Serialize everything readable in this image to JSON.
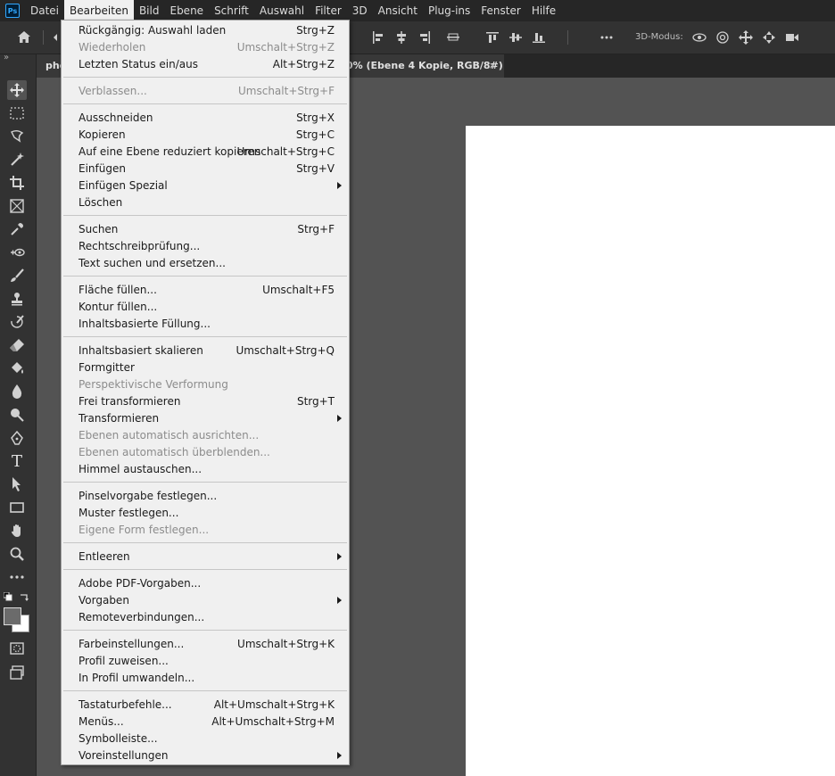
{
  "menubar": {
    "logo": "Ps",
    "items": [
      "Datei",
      "Bearbeiten",
      "Bild",
      "Ebene",
      "Schrift",
      "Auswahl",
      "Filter",
      "3D",
      "Ansicht",
      "Plug-ins",
      "Fenster",
      "Hilfe"
    ],
    "active_index": 1
  },
  "options": {
    "mode_label": "3D-Modus:"
  },
  "tabs": [
    {
      "label": "pho"
    },
    {
      "label": "0% (Ebene 4 Kopie, RGB/8#) *",
      "close": "×"
    }
  ],
  "toolbar": {
    "collapse": "»",
    "tools": [
      "move-tool-icon",
      "marquee-tool-icon",
      "lasso-tool-icon",
      "magic-wand-icon",
      "crop-tool-icon",
      "frame-tool-icon",
      "eyedropper-icon",
      "healing-brush-icon",
      "brush-tool-icon",
      "stamp-tool-icon",
      "history-brush-icon",
      "eraser-icon",
      "paint-bucket-icon",
      "blur-tool-icon",
      "dodge-tool-icon",
      "pen-tool-icon",
      "type-tool-icon",
      "path-select-icon",
      "rectangle-tool-icon",
      "hand-tool-icon",
      "zoom-tool-icon",
      "more-tools-icon"
    ],
    "text_tool_label": "T"
  },
  "menu": {
    "groups": [
      [
        {
          "label": "Rückgängig: Auswahl laden",
          "shortcut": "Strg+Z"
        },
        {
          "label": "Wiederholen",
          "shortcut": "Umschalt+Strg+Z",
          "disabled": true
        },
        {
          "label": "Letzten Status ein/aus",
          "shortcut": "Alt+Strg+Z"
        }
      ],
      [
        {
          "label": "Verblassen...",
          "shortcut": "Umschalt+Strg+F",
          "disabled": true
        }
      ],
      [
        {
          "label": "Ausschneiden",
          "shortcut": "Strg+X"
        },
        {
          "label": "Kopieren",
          "shortcut": "Strg+C"
        },
        {
          "label": "Auf eine Ebene reduziert kopieren",
          "shortcut": "Umschalt+Strg+C"
        },
        {
          "label": "Einfügen",
          "shortcut": "Strg+V"
        },
        {
          "label": "Einfügen Spezial",
          "submenu": true
        },
        {
          "label": "Löschen"
        }
      ],
      [
        {
          "label": "Suchen",
          "shortcut": "Strg+F"
        },
        {
          "label": "Rechtschreibprüfung..."
        },
        {
          "label": "Text suchen und ersetzen..."
        }
      ],
      [
        {
          "label": "Fläche füllen...",
          "shortcut": "Umschalt+F5"
        },
        {
          "label": "Kontur füllen..."
        },
        {
          "label": "Inhaltsbasierte Füllung..."
        }
      ],
      [
        {
          "label": "Inhaltsbasiert skalieren",
          "shortcut": "Umschalt+Strg+Q"
        },
        {
          "label": "Formgitter"
        },
        {
          "label": "Perspektivische Verformung",
          "disabled": true
        },
        {
          "label": "Frei transformieren",
          "shortcut": "Strg+T"
        },
        {
          "label": "Transformieren",
          "submenu": true
        },
        {
          "label": "Ebenen automatisch ausrichten...",
          "disabled": true
        },
        {
          "label": "Ebenen automatisch überblenden...",
          "disabled": true
        },
        {
          "label": "Himmel austauschen..."
        }
      ],
      [
        {
          "label": "Pinselvorgabe festlegen..."
        },
        {
          "label": "Muster festlegen..."
        },
        {
          "label": "Eigene Form festlegen...",
          "disabled": true
        }
      ],
      [
        {
          "label": "Entleeren",
          "submenu": true
        }
      ],
      [
        {
          "label": "Adobe PDF-Vorgaben..."
        },
        {
          "label": "Vorgaben",
          "submenu": true
        },
        {
          "label": "Remoteverbindungen..."
        }
      ],
      [
        {
          "label": "Farbeinstellungen...",
          "shortcut": "Umschalt+Strg+K"
        },
        {
          "label": "Profil zuweisen..."
        },
        {
          "label": "In Profil umwandeln..."
        }
      ],
      [
        {
          "label": "Tastaturbefehle...",
          "shortcut": "Alt+Umschalt+Strg+K"
        },
        {
          "label": "Menüs...",
          "shortcut": "Alt+Umschalt+Strg+M"
        },
        {
          "label": "Symbolleiste..."
        },
        {
          "label": "Voreinstellungen",
          "submenu": true
        }
      ]
    ]
  },
  "colors": {
    "menubar_bg": "#262626",
    "panel_bg": "#323232",
    "canvas_bg": "#535353",
    "menu_bg": "#f0f0f0",
    "disabled_text": "#8c8c8c",
    "foreground_swatch": "#6b6b6b",
    "background_swatch": "#ffffff"
  }
}
